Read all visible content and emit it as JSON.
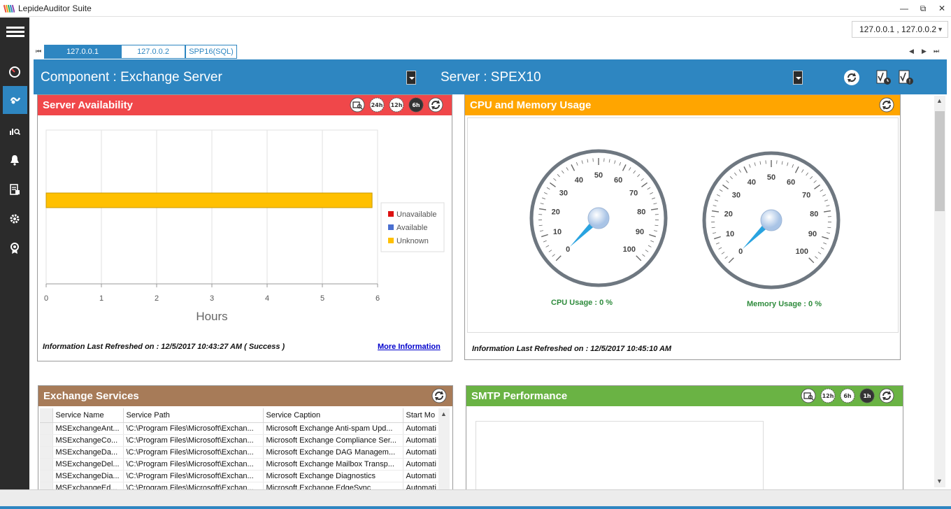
{
  "app": {
    "title": "LepideAuditor Suite"
  },
  "window": {
    "minimize": "—",
    "restore": "⧉",
    "close": "✕"
  },
  "server_selector": {
    "value": "127.0.0.1 , 127.0.0.2"
  },
  "tabs": [
    {
      "label": "127.0.0.1",
      "active": true
    },
    {
      "label": "127.0.0.2",
      "active": false
    },
    {
      "label": "SPP16(SQL)",
      "active": false
    }
  ],
  "header": {
    "component_label": "Component : Exchange Server",
    "server_label": "Server : SPEX10"
  },
  "sidebar": {
    "items": [
      {
        "icon": "dashboard-icon"
      },
      {
        "icon": "health-monitor-icon",
        "active": true
      },
      {
        "icon": "analytics-icon"
      },
      {
        "icon": "alerts-bell-icon"
      },
      {
        "icon": "reports-icon"
      },
      {
        "icon": "settings-gear-icon"
      },
      {
        "icon": "license-badge-icon"
      }
    ]
  },
  "colors": {
    "accent": "#2e86c1",
    "availability": "#f0474a",
    "cpu": "#ffa500",
    "services": "#a77b58",
    "smtp": "#6ab344"
  },
  "availability": {
    "title": "Server Availability",
    "icons": [
      "search-report-icon",
      "24h-icon",
      "12h-icon",
      "6h-icon",
      "refresh-icon"
    ],
    "icon_labels": {
      "h24": "24h",
      "h12": "12h",
      "h6": "6h"
    },
    "refreshed": "Information Last Refreshed on : 12/5/2017 10:43:27 AM ( Success )",
    "more_info": "More Information"
  },
  "cpu_memory": {
    "title": "CPU and Memory Usage",
    "cpu_label": "CPU Usage : 0 %",
    "memory_label": "Memory Usage : 0 %",
    "refreshed": "Information Last Refreshed on : 12/5/2017 10:45:10 AM",
    "gauge_ticks": [
      "0",
      "10",
      "20",
      "30",
      "40",
      "50",
      "60",
      "70",
      "80",
      "90",
      "100"
    ],
    "cpu_value": 0,
    "memory_value": 0
  },
  "services": {
    "title": "Exchange Services",
    "columns": [
      "Service Name",
      "Service Path",
      "Service Caption",
      "Start Mo"
    ],
    "rows": [
      [
        "MSExchangeAnt...",
        "\\C:\\Program Files\\Microsoft\\Exchan...",
        "Microsoft Exchange Anti-spam Upd...",
        "Automati"
      ],
      [
        "MSExchangeCo...",
        "\\C:\\Program Files\\Microsoft\\Exchan...",
        "Microsoft Exchange Compliance Ser...",
        "Automati"
      ],
      [
        "MSExchangeDa...",
        "\\C:\\Program Files\\Microsoft\\Exchan...",
        "Microsoft Exchange DAG Managem...",
        "Automati"
      ],
      [
        "MSExchangeDel...",
        "\\C:\\Program Files\\Microsoft\\Exchan...",
        "Microsoft Exchange Mailbox Transp...",
        "Automati"
      ],
      [
        "MSExchangeDia...",
        "\\C:\\Program Files\\Microsoft\\Exchan...",
        "Microsoft Exchange Diagnostics",
        "Automati"
      ],
      [
        "MSExchangeEd...",
        "\\C:\\Program Files\\Microsoft\\Exchan...",
        "Microsoft Exchange EdgeSync",
        "Automati"
      ]
    ]
  },
  "smtp": {
    "title": "SMTP Performance",
    "icons": [
      "search-report-icon",
      "12h-icon",
      "6h-icon",
      "1h-icon",
      "refresh-icon"
    ],
    "icon_labels": {
      "h12": "12h",
      "h6": "6h",
      "h1": "1h"
    }
  },
  "chart_data": {
    "type": "bar",
    "orientation": "horizontal",
    "xlabel": "Hours",
    "xlim": [
      0,
      6
    ],
    "x_ticks": [
      "0",
      "1",
      "2",
      "3",
      "4",
      "5",
      "6"
    ],
    "series": [
      {
        "name": "Unavailable",
        "color": "#dd1111",
        "values": [
          0
        ]
      },
      {
        "name": "Available",
        "color": "#4a6fd0",
        "values": [
          0
        ]
      },
      {
        "name": "Unknown",
        "color": "#ffc000",
        "values": [
          5.9
        ]
      }
    ],
    "legend": "right",
    "grid": true
  }
}
